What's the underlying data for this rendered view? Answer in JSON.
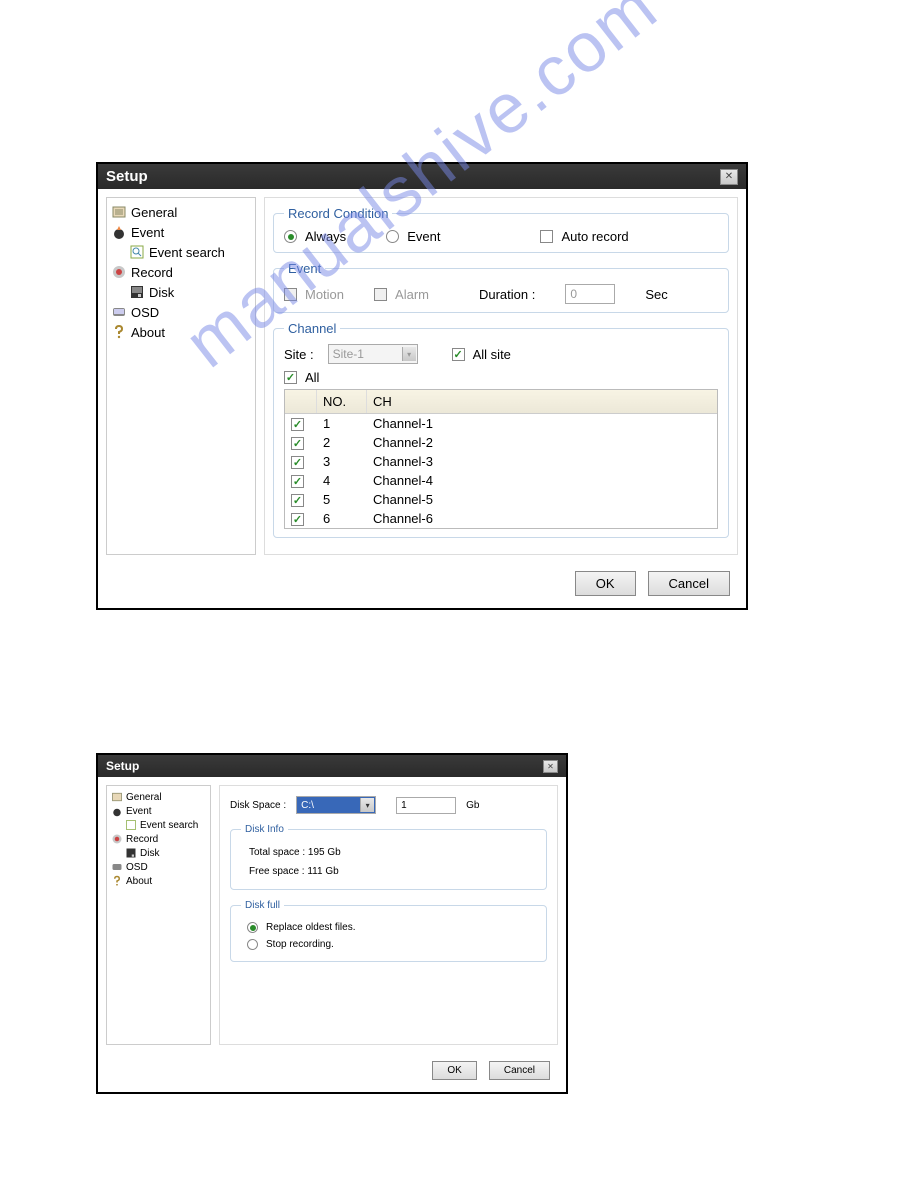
{
  "watermark": "manualshive.com",
  "window1": {
    "title": "Setup",
    "sidebar": {
      "items": [
        {
          "label": "General",
          "icon": "properties"
        },
        {
          "label": "Event",
          "icon": "event"
        },
        {
          "label": "Event search",
          "icon": "search",
          "child": true
        },
        {
          "label": "Record",
          "icon": "record"
        },
        {
          "label": "Disk",
          "icon": "disk",
          "child": true
        },
        {
          "label": "OSD",
          "icon": "osd"
        },
        {
          "label": "About",
          "icon": "help"
        }
      ]
    },
    "record_condition": {
      "legend": "Record Condition",
      "always": "Always",
      "event": "Event",
      "auto_record": "Auto record"
    },
    "event_group": {
      "legend": "Event",
      "motion": "Motion",
      "alarm": "Alarm",
      "duration_label": "Duration :",
      "duration_value": "0",
      "sec": "Sec"
    },
    "channel": {
      "legend": "Channel",
      "site_label": "Site :",
      "site_value": "Site-1",
      "all_site": "All site",
      "all": "All",
      "headers": {
        "no": "NO.",
        "ch": "CH"
      },
      "rows": [
        {
          "no": "1",
          "ch": "Channel-1"
        },
        {
          "no": "2",
          "ch": "Channel-2"
        },
        {
          "no": "3",
          "ch": "Channel-3"
        },
        {
          "no": "4",
          "ch": "Channel-4"
        },
        {
          "no": "5",
          "ch": "Channel-5"
        },
        {
          "no": "6",
          "ch": "Channel-6"
        }
      ]
    },
    "buttons": {
      "ok": "OK",
      "cancel": "Cancel"
    }
  },
  "window2": {
    "title": "Setup",
    "sidebar": {
      "items": [
        {
          "label": "General",
          "icon": "properties"
        },
        {
          "label": "Event",
          "icon": "event"
        },
        {
          "label": "Event search",
          "icon": "search",
          "child": true
        },
        {
          "label": "Record",
          "icon": "record"
        },
        {
          "label": "Disk",
          "icon": "disk",
          "child": true
        },
        {
          "label": "OSD",
          "icon": "osd"
        },
        {
          "label": "About",
          "icon": "help"
        }
      ]
    },
    "disk_space": {
      "label": "Disk Space :",
      "drive": "C:\\",
      "size": "1",
      "unit": "Gb"
    },
    "disk_info": {
      "legend": "Disk Info",
      "total": "Total space : 195 Gb",
      "free": "Free space : 111 Gb"
    },
    "disk_full": {
      "legend": "Disk full",
      "replace": "Replace oldest files.",
      "stop": "Stop recording."
    },
    "buttons": {
      "ok": "OK",
      "cancel": "Cancel"
    }
  }
}
